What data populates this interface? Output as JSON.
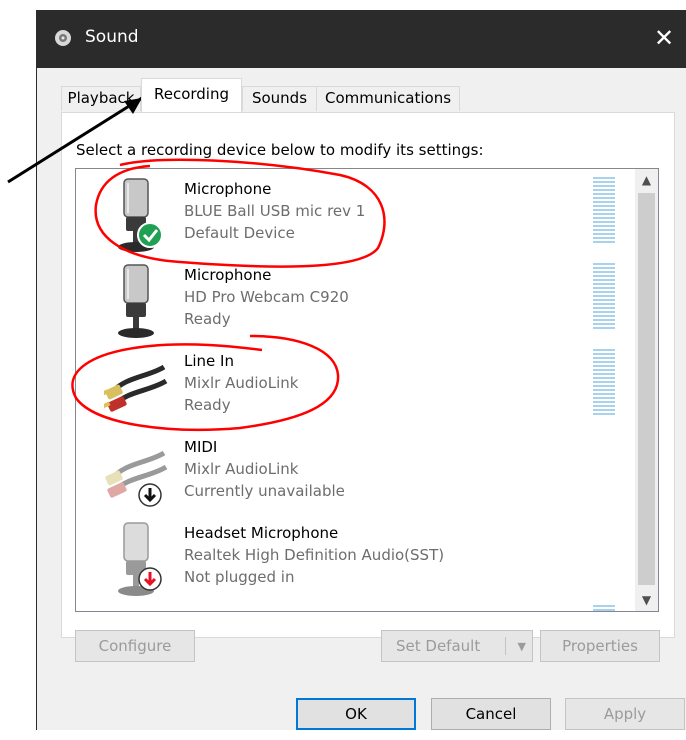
{
  "window": {
    "title": "Sound",
    "close_label": "✕"
  },
  "tabs": [
    {
      "label": "Playback",
      "active": false
    },
    {
      "label": "Recording",
      "active": true
    },
    {
      "label": "Sounds",
      "active": false
    },
    {
      "label": "Communications",
      "active": false
    }
  ],
  "instruction": "Select a recording device below to modify its settings:",
  "devices": [
    {
      "name": "Microphone",
      "description": "BLUE Ball USB mic rev 1",
      "status": "Default Device",
      "icon": "microphone-default-icon"
    },
    {
      "name": "Microphone",
      "description": "HD Pro Webcam C920",
      "status": "Ready",
      "icon": "microphone-icon"
    },
    {
      "name": "Line In",
      "description": "Mixlr AudioLink",
      "status": "Ready",
      "icon": "line-in-cable-icon"
    },
    {
      "name": "MIDI",
      "description": "Mixlr AudioLink",
      "status": "Currently unavailable",
      "icon": "midi-cable-unavailable-icon"
    },
    {
      "name": "Headset Microphone",
      "description": "Realtek High Definition Audio(SST)",
      "status": "Not plugged in",
      "icon": "headset-microphone-unplugged-icon"
    }
  ],
  "buttons": {
    "configure": "Configure",
    "set_default": "Set Default",
    "properties": "Properties",
    "ok": "OK",
    "cancel": "Cancel",
    "apply": "Apply"
  },
  "colors": {
    "titlebar": "#2b2b2b",
    "default_check": "#1fa052",
    "unplugged_arrow": "#e81123",
    "annotation": "#ff0000",
    "level_meter": "#a9d3ec"
  }
}
